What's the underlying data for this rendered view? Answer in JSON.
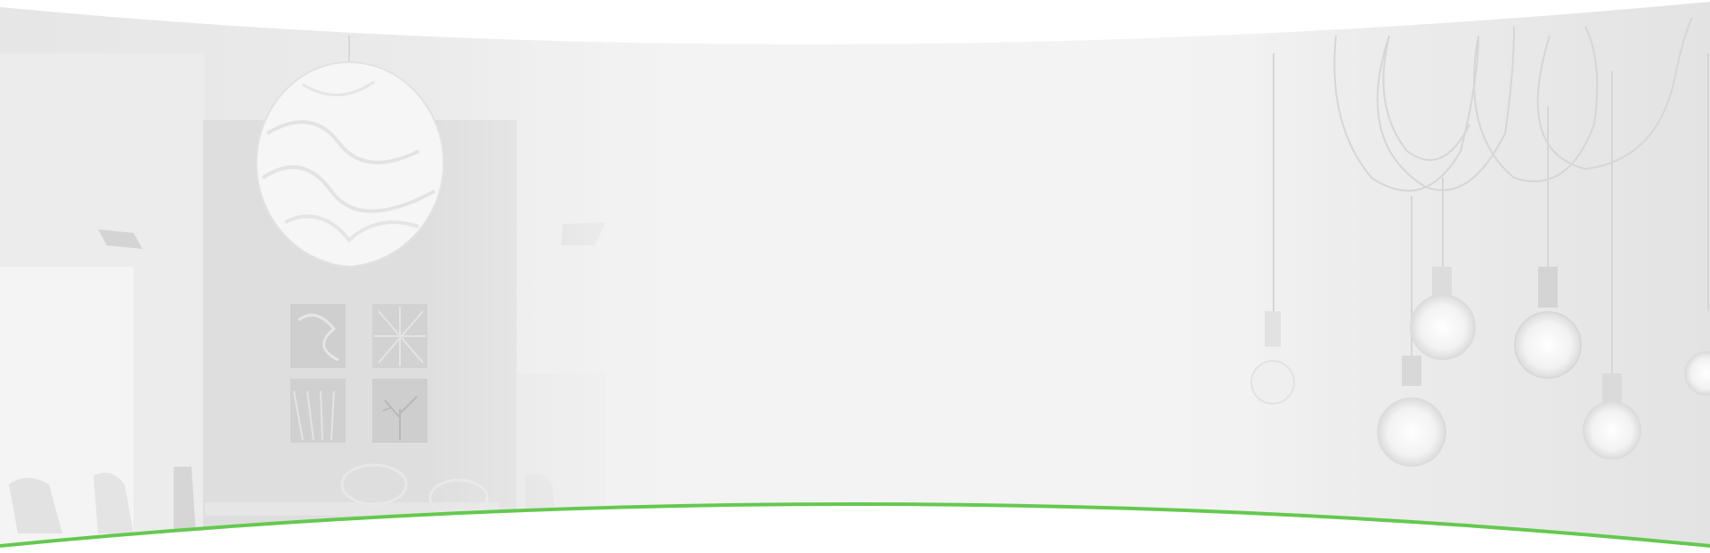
{
  "banner": {
    "background_color": "#ffffff",
    "photo_tint": "#f2f2f2",
    "accent_curve_color": "#64c94f",
    "left_scene": "dining-room-with-pendant-lamp",
    "right_scene": "hanging-edison-bulbs"
  }
}
